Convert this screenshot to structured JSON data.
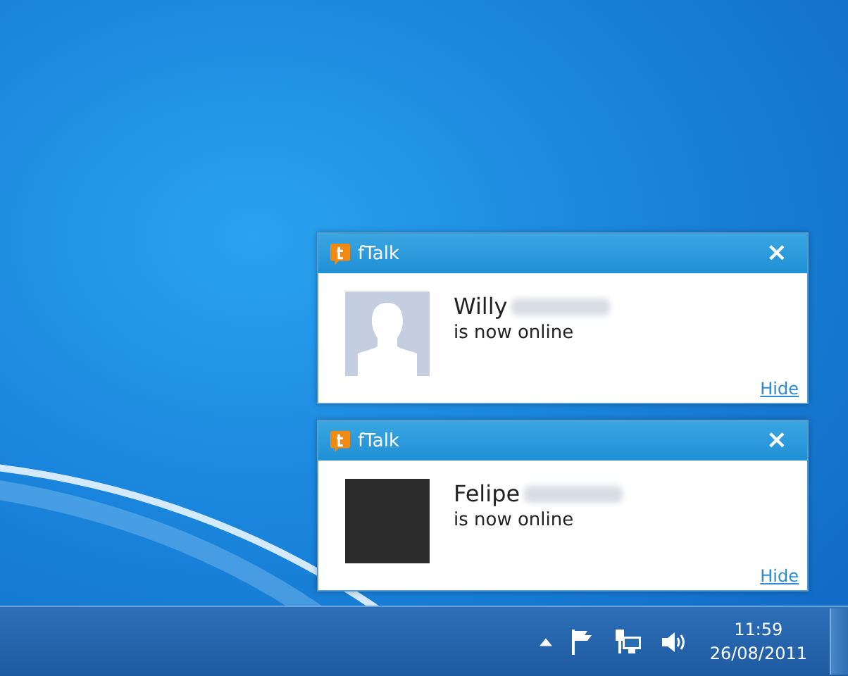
{
  "notifications": [
    {
      "app_name": "fTalk",
      "close": "×",
      "contact_name": "Willy",
      "name_redacted": true,
      "kind": "silhouette",
      "message": "is now online",
      "hide_link": "Hide"
    },
    {
      "app_name": "fTalk",
      "close": "×",
      "contact_name": "Felipe",
      "name_redacted": true,
      "kind": "photo",
      "message": "is now online",
      "hide_link": "Hide"
    }
  ],
  "taskbar": {
    "clock_time": "11:59",
    "clock_date": "26/08/2011"
  }
}
